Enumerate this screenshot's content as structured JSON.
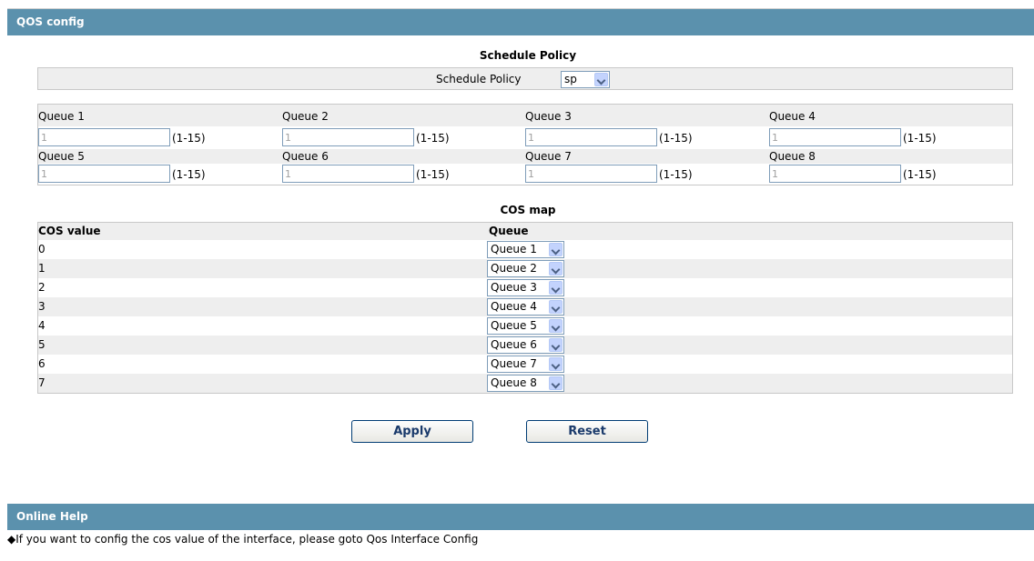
{
  "qos_section": {
    "title": "QOS config"
  },
  "schedule": {
    "caption": "Schedule Policy",
    "label": "Schedule Policy",
    "value": "sp"
  },
  "queues": [
    {
      "label": "Queue 1",
      "value": "1",
      "range": "(1-15)"
    },
    {
      "label": "Queue 2",
      "value": "1",
      "range": "(1-15)"
    },
    {
      "label": "Queue 3",
      "value": "1",
      "range": "(1-15)"
    },
    {
      "label": "Queue 4",
      "value": "1",
      "range": "(1-15)"
    },
    {
      "label": "Queue 5",
      "value": "1",
      "range": "(1-15)"
    },
    {
      "label": "Queue 6",
      "value": "1",
      "range": "(1-15)"
    },
    {
      "label": "Queue 7",
      "value": "1",
      "range": "(1-15)"
    },
    {
      "label": "Queue 8",
      "value": "1",
      "range": "(1-15)"
    }
  ],
  "cos_map": {
    "caption": "COS map",
    "headers": {
      "cos": "COS value",
      "queue": "Queue"
    },
    "rows": [
      {
        "cos": "0",
        "queue": "Queue 1"
      },
      {
        "cos": "1",
        "queue": "Queue 2"
      },
      {
        "cos": "2",
        "queue": "Queue 3"
      },
      {
        "cos": "3",
        "queue": "Queue 4"
      },
      {
        "cos": "4",
        "queue": "Queue 5"
      },
      {
        "cos": "5",
        "queue": "Queue 6"
      },
      {
        "cos": "6",
        "queue": "Queue 7"
      },
      {
        "cos": "7",
        "queue": "Queue 8"
      }
    ]
  },
  "buttons": {
    "apply": "Apply",
    "reset": "Reset"
  },
  "help": {
    "title": "Online Help",
    "text": "◆If you want to config the cos value of the interface, please goto Qos Interface Config"
  },
  "colors": {
    "section_bar": "#5b91ad",
    "row_alt": "#eeeeee"
  }
}
